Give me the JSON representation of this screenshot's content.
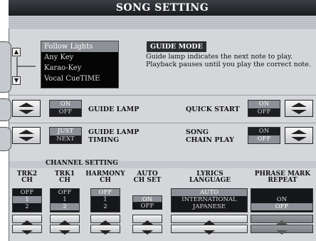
{
  "title": "SONG SETTING",
  "guide_list": {
    "items": [
      "Follow Lights",
      "Any Key",
      "Karao-Key",
      "Vocal CueTIME"
    ],
    "selected_index": 0
  },
  "guide_mode": {
    "title": "GUIDE MODE",
    "description": "Guide lamp indicates the next note to play. Playback pauses until you play the correct note."
  },
  "guide_lamp": {
    "label": "GUIDE LAMP",
    "options": [
      "ON",
      "OFF"
    ],
    "selected": "ON"
  },
  "guide_lamp_timing": {
    "label_line1": "GUIDE LAMP",
    "label_line2": "TIMING",
    "options": [
      "JUST",
      "NEXT"
    ],
    "selected": "JUST"
  },
  "quick_start": {
    "label": "QUICK START",
    "options": [
      "ON",
      "OFF"
    ],
    "selected": "ON"
  },
  "song_chain_play": {
    "label_line1": "SONG",
    "label_line2": "CHAIN PLAY",
    "options": [
      "ON",
      "OFF"
    ],
    "selected": "OFF"
  },
  "channel_setting": {
    "title": "CHANNEL SETTING",
    "columns": [
      {
        "head1": "TRK2",
        "head2": "CH",
        "values": [
          "OFF",
          "1",
          "2"
        ],
        "selected": "1"
      },
      {
        "head1": "TRK1",
        "head2": "CH",
        "values": [
          "OFF",
          "1",
          "2"
        ],
        "selected": "2"
      },
      {
        "head1": "HARMONY",
        "head2": "CH",
        "values": [
          "OFF",
          "1",
          "2"
        ],
        "selected": "OFF"
      },
      {
        "head1": "AUTO",
        "head2": "CH SET",
        "values": [
          "",
          "ON",
          "OFF"
        ],
        "selected": "ON"
      },
      {
        "head1": "LYRICS",
        "head2": "LANGUAGE",
        "values": [
          "AUTO",
          "INTERNATIONAL",
          "JAPANESE"
        ],
        "selected": "AUTO"
      },
      {
        "head1": "PHRASE MARK",
        "head2": "REPEAT",
        "values": [
          "",
          "ON",
          "OFF"
        ],
        "selected": "OFF"
      }
    ]
  },
  "colors": {
    "title_bg": "#1b1c20",
    "panel_bg": "#d4d6da",
    "list_bg": "#050505",
    "selected_bg": "#8d9097"
  }
}
